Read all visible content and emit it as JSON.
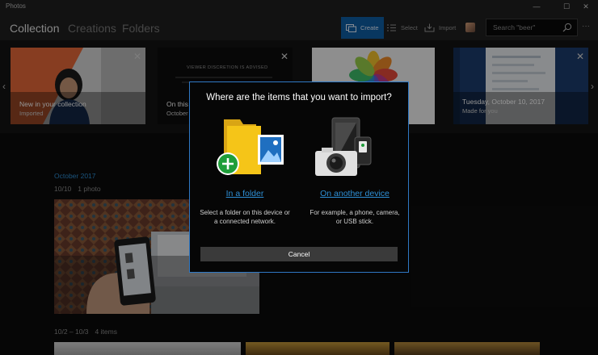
{
  "window": {
    "title": "Photos",
    "minimize_glyph": "—",
    "maximize_glyph": "☐",
    "close_glyph": "✕"
  },
  "header": {
    "tabs": [
      {
        "label": "Collection",
        "active": true
      },
      {
        "label": "Creations",
        "active": false
      },
      {
        "label": "Folders",
        "active": false
      }
    ],
    "toolbar": {
      "create_label": "Create",
      "select_label": "Select",
      "import_label": "Import"
    },
    "search": {
      "placeholder": "Search \"beer\""
    },
    "more_glyph": "···"
  },
  "hero": {
    "prev_glyph": "‹",
    "next_glyph": "›",
    "cards": [
      {
        "title": "New in your collection",
        "subtitle": "Imported"
      },
      {
        "title": "On this",
        "subtitle": "October",
        "overlay_text": "VIEWER DISCRETION IS ADVISED"
      },
      {
        "title": "",
        "subtitle": ""
      },
      {
        "title": "Tuesday, October 10, 2017",
        "subtitle": "Made for you"
      }
    ]
  },
  "collection": {
    "month": "October 2017",
    "groups": [
      {
        "date": "10/10",
        "count": "1 photo"
      },
      {
        "date": "10/2 – 10/3",
        "count": "4 items"
      }
    ]
  },
  "dialog": {
    "title": "Where are the items that you want to import?",
    "options": [
      {
        "link": "In a folder",
        "description_line1": "Select a folder on this device or",
        "description_line2": "a connected network."
      },
      {
        "link": "On another device",
        "description_line1": "For example, a phone, camera,",
        "description_line2": "or USB stick."
      }
    ],
    "cancel_label": "Cancel"
  },
  "colors": {
    "accent": "#2e8fd6",
    "create_active": "#0f5fa6",
    "folder_yellow": "#f5c518",
    "plus_green": "#1f9e3a"
  }
}
